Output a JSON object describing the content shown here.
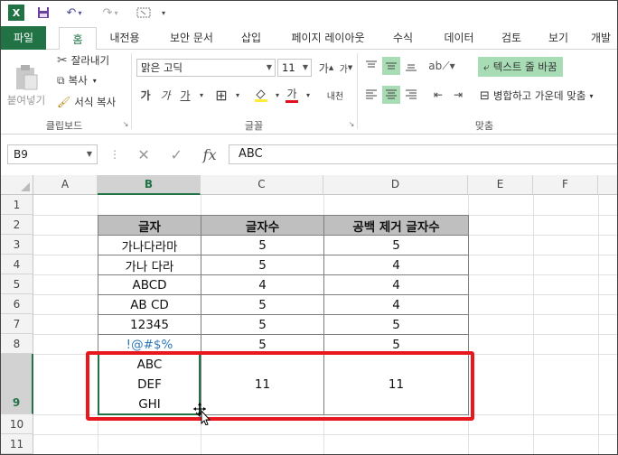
{
  "app": {
    "name": "Excel"
  },
  "tabs": [
    {
      "label": "파일"
    },
    {
      "label": "홈"
    },
    {
      "label": "내전용"
    },
    {
      "label": "보안 문서"
    },
    {
      "label": "삽입"
    },
    {
      "label": "페이지 레이아웃"
    },
    {
      "label": "수식"
    },
    {
      "label": "데이터"
    },
    {
      "label": "검토"
    },
    {
      "label": "보기"
    },
    {
      "label": "개발"
    }
  ],
  "ribbon": {
    "clipboard": {
      "paste": "붙여넣기",
      "cut": "잘라내기",
      "copy": "복사",
      "format_painter": "서식 복사",
      "label": "클립보드"
    },
    "font": {
      "family": "맑은 고딕",
      "size": "11",
      "bold": "가",
      "italic": "가",
      "underline": "가",
      "grow": "가",
      "shrink": "가",
      "color_letter": "가",
      "phonetic": "내천",
      "label": "글꼴"
    },
    "alignment": {
      "wrap_text": "텍스트 줄 바꿈",
      "merge_center": "병합하고 가운데 맞춤",
      "label": "맞춤"
    }
  },
  "formula_bar": {
    "name_box": "B9",
    "fx": "fx",
    "value": "ABC"
  },
  "columns": [
    "A",
    "B",
    "C",
    "D",
    "E",
    "F"
  ],
  "rows": [
    "1",
    "2",
    "3",
    "4",
    "5",
    "6",
    "7",
    "8",
    "9",
    "10",
    "11"
  ],
  "table": {
    "headers": [
      "글자",
      "글자수",
      "공백 제거 글자수"
    ],
    "rows": [
      [
        "가나다라마",
        "5",
        "5"
      ],
      [
        "가나 다라",
        "5",
        "4"
      ],
      [
        "ABCD",
        "4",
        "4"
      ],
      [
        "AB CD",
        "5",
        "4"
      ],
      [
        "12345",
        "5",
        "5"
      ],
      [
        "!@#$%",
        "5",
        "5"
      ]
    ],
    "multi_line_cell": [
      "ABC",
      "DEF",
      "GHI"
    ],
    "multi_count": "11",
    "multi_trim": "11"
  },
  "colors": {
    "accent": "#217346",
    "highlight": "#e8171e",
    "header_fill": "#bfbfbf",
    "link_blue": "#2e75b6"
  }
}
